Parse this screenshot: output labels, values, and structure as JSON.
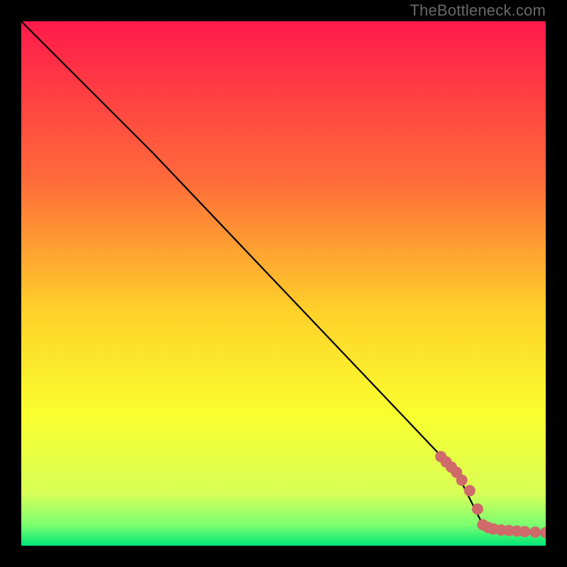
{
  "attribution": "TheBottleneck.com",
  "chart_data": {
    "type": "line",
    "title": "",
    "xlabel": "",
    "ylabel": "",
    "xlim": [
      0,
      100
    ],
    "ylim": [
      0,
      100
    ],
    "series": [
      {
        "name": "curve",
        "x": [
          0,
          25,
          83,
          88,
          100
        ],
        "y": [
          100,
          75,
          14,
          4,
          2.5
        ]
      }
    ],
    "markers": {
      "name": "highlighted-points",
      "x": [
        80,
        81,
        82,
        83,
        84,
        85.5,
        87,
        88,
        89,
        90,
        91.5,
        93,
        94.5,
        96,
        98,
        100
      ],
      "y": [
        17,
        16,
        15,
        14,
        12.5,
        10.5,
        7,
        4,
        3.5,
        3.2,
        3,
        2.9,
        2.8,
        2.7,
        2.6,
        2.5
      ]
    },
    "background_gradient": {
      "stops": [
        {
          "offset": 0,
          "color": "#ff1a4b"
        },
        {
          "offset": 30,
          "color": "#ff6a3a"
        },
        {
          "offset": 55,
          "color": "#ffd02a"
        },
        {
          "offset": 75,
          "color": "#f9ff2e"
        },
        {
          "offset": 90,
          "color": "#d8ff57"
        },
        {
          "offset": 96,
          "color": "#7cff70"
        },
        {
          "offset": 100,
          "color": "#00e676"
        }
      ]
    }
  }
}
